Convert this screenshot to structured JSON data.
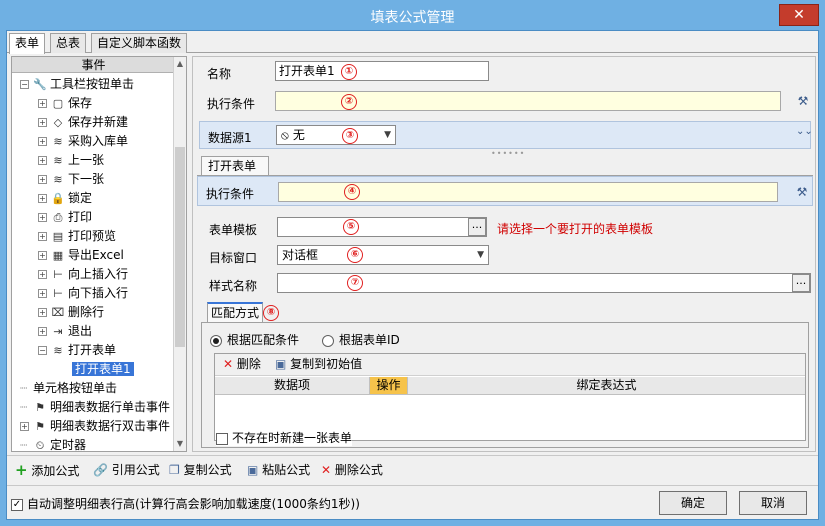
{
  "window": {
    "title": "填表公式管理",
    "close_glyph": "✕"
  },
  "top_tabs": [
    "表单",
    "总表",
    "自定义脚本函数"
  ],
  "tree": {
    "header": "事件",
    "nodes": [
      {
        "label": "工具栏按钮单击",
        "icon": "wrench-icon",
        "glyph": "🔧",
        "level": 0,
        "expander": "−"
      },
      {
        "label": "保存",
        "icon": "save-icon",
        "glyph": "▢",
        "level": 1,
        "expander": "+"
      },
      {
        "label": "保存并新建",
        "icon": "shield-icon",
        "glyph": "◇",
        "level": 1,
        "expander": "+"
      },
      {
        "label": "采购入库单",
        "icon": "stack-icon",
        "glyph": "≋",
        "level": 1,
        "expander": "+"
      },
      {
        "label": "上一张",
        "icon": "stack-icon",
        "glyph": "≋",
        "level": 1,
        "expander": "+"
      },
      {
        "label": "下一张",
        "icon": "stack-icon",
        "glyph": "≋",
        "level": 1,
        "expander": "+"
      },
      {
        "label": "锁定",
        "icon": "lock-icon",
        "glyph": "🔒",
        "level": 1,
        "expander": "+"
      },
      {
        "label": "打印",
        "icon": "printer-icon",
        "glyph": "⎙",
        "level": 1,
        "expander": "+"
      },
      {
        "label": "打印预览",
        "icon": "preview-icon",
        "glyph": "▤",
        "level": 1,
        "expander": "+"
      },
      {
        "label": "导出Excel",
        "icon": "excel-icon",
        "glyph": "▦",
        "level": 1,
        "expander": "+"
      },
      {
        "label": "向上插入行",
        "icon": "insert-up-icon",
        "glyph": "⊢",
        "level": 1,
        "expander": "+"
      },
      {
        "label": "向下插入行",
        "icon": "insert-down-icon",
        "glyph": "⊢",
        "level": 1,
        "expander": "+"
      },
      {
        "label": "删除行",
        "icon": "delete-row-icon",
        "glyph": "⌧",
        "level": 1,
        "expander": "+"
      },
      {
        "label": "退出",
        "icon": "exit-icon",
        "glyph": "⇥",
        "level": 1,
        "expander": "+"
      },
      {
        "label": "打开表单",
        "icon": "stack-icon",
        "glyph": "≋",
        "level": 1,
        "expander": "−"
      },
      {
        "label": "打开表单1",
        "icon": "",
        "glyph": "",
        "level": 2,
        "expander": "",
        "selected": true
      },
      {
        "label": "单元格按钮单击",
        "icon": "",
        "glyph": "",
        "level": 0,
        "expander": ""
      },
      {
        "label": "明细表数据行单击事件",
        "icon": "flag-icon",
        "glyph": "⚑",
        "level": 0,
        "expander": ""
      },
      {
        "label": "明细表数据行双击事件",
        "icon": "flag-icon",
        "glyph": "⚑",
        "level": 0,
        "expander": "+"
      },
      {
        "label": "定时器",
        "icon": "timer-icon",
        "glyph": "⏲",
        "level": 0,
        "expander": ""
      }
    ]
  },
  "form": {
    "name_label": "名称",
    "name_value": "打开表单1",
    "condition_label": "执行条件",
    "datasource_label": "数据源1",
    "datasource_value": "无",
    "subtab_label": "打开表单",
    "condition2_label": "执行条件",
    "template_label": "表单模板",
    "template_hint": "请选择一个要打开的表单模板",
    "target_label": "目标窗口",
    "target_value": "对话框",
    "style_label": "样式名称",
    "match_tab_label": "匹配方式",
    "radio_match_condition": "根据匹配条件",
    "radio_match_id": "根据表单ID",
    "grid_delete": "删除",
    "grid_copy_initial": "复制到初始值",
    "grid_col_data": "数据项",
    "grid_col_op": "操作",
    "grid_col_expr": "绑定表达式",
    "create_new_checkbox": "不存在时新建一张表单",
    "markers": [
      "①",
      "②",
      "③",
      "④",
      "⑤",
      "⑥",
      "⑦",
      "⑧"
    ],
    "dots": "..."
  },
  "toolbar": {
    "add": "添加公式",
    "ref": "引用公式",
    "copy": "复制公式",
    "paste": "粘贴公式",
    "delete": "删除公式"
  },
  "footer": {
    "auto_height_checkbox": "自动调整明细表行高(计算行高会影响加载速度(1000条约1秒))",
    "ok": "确定",
    "cancel": "取消"
  }
}
